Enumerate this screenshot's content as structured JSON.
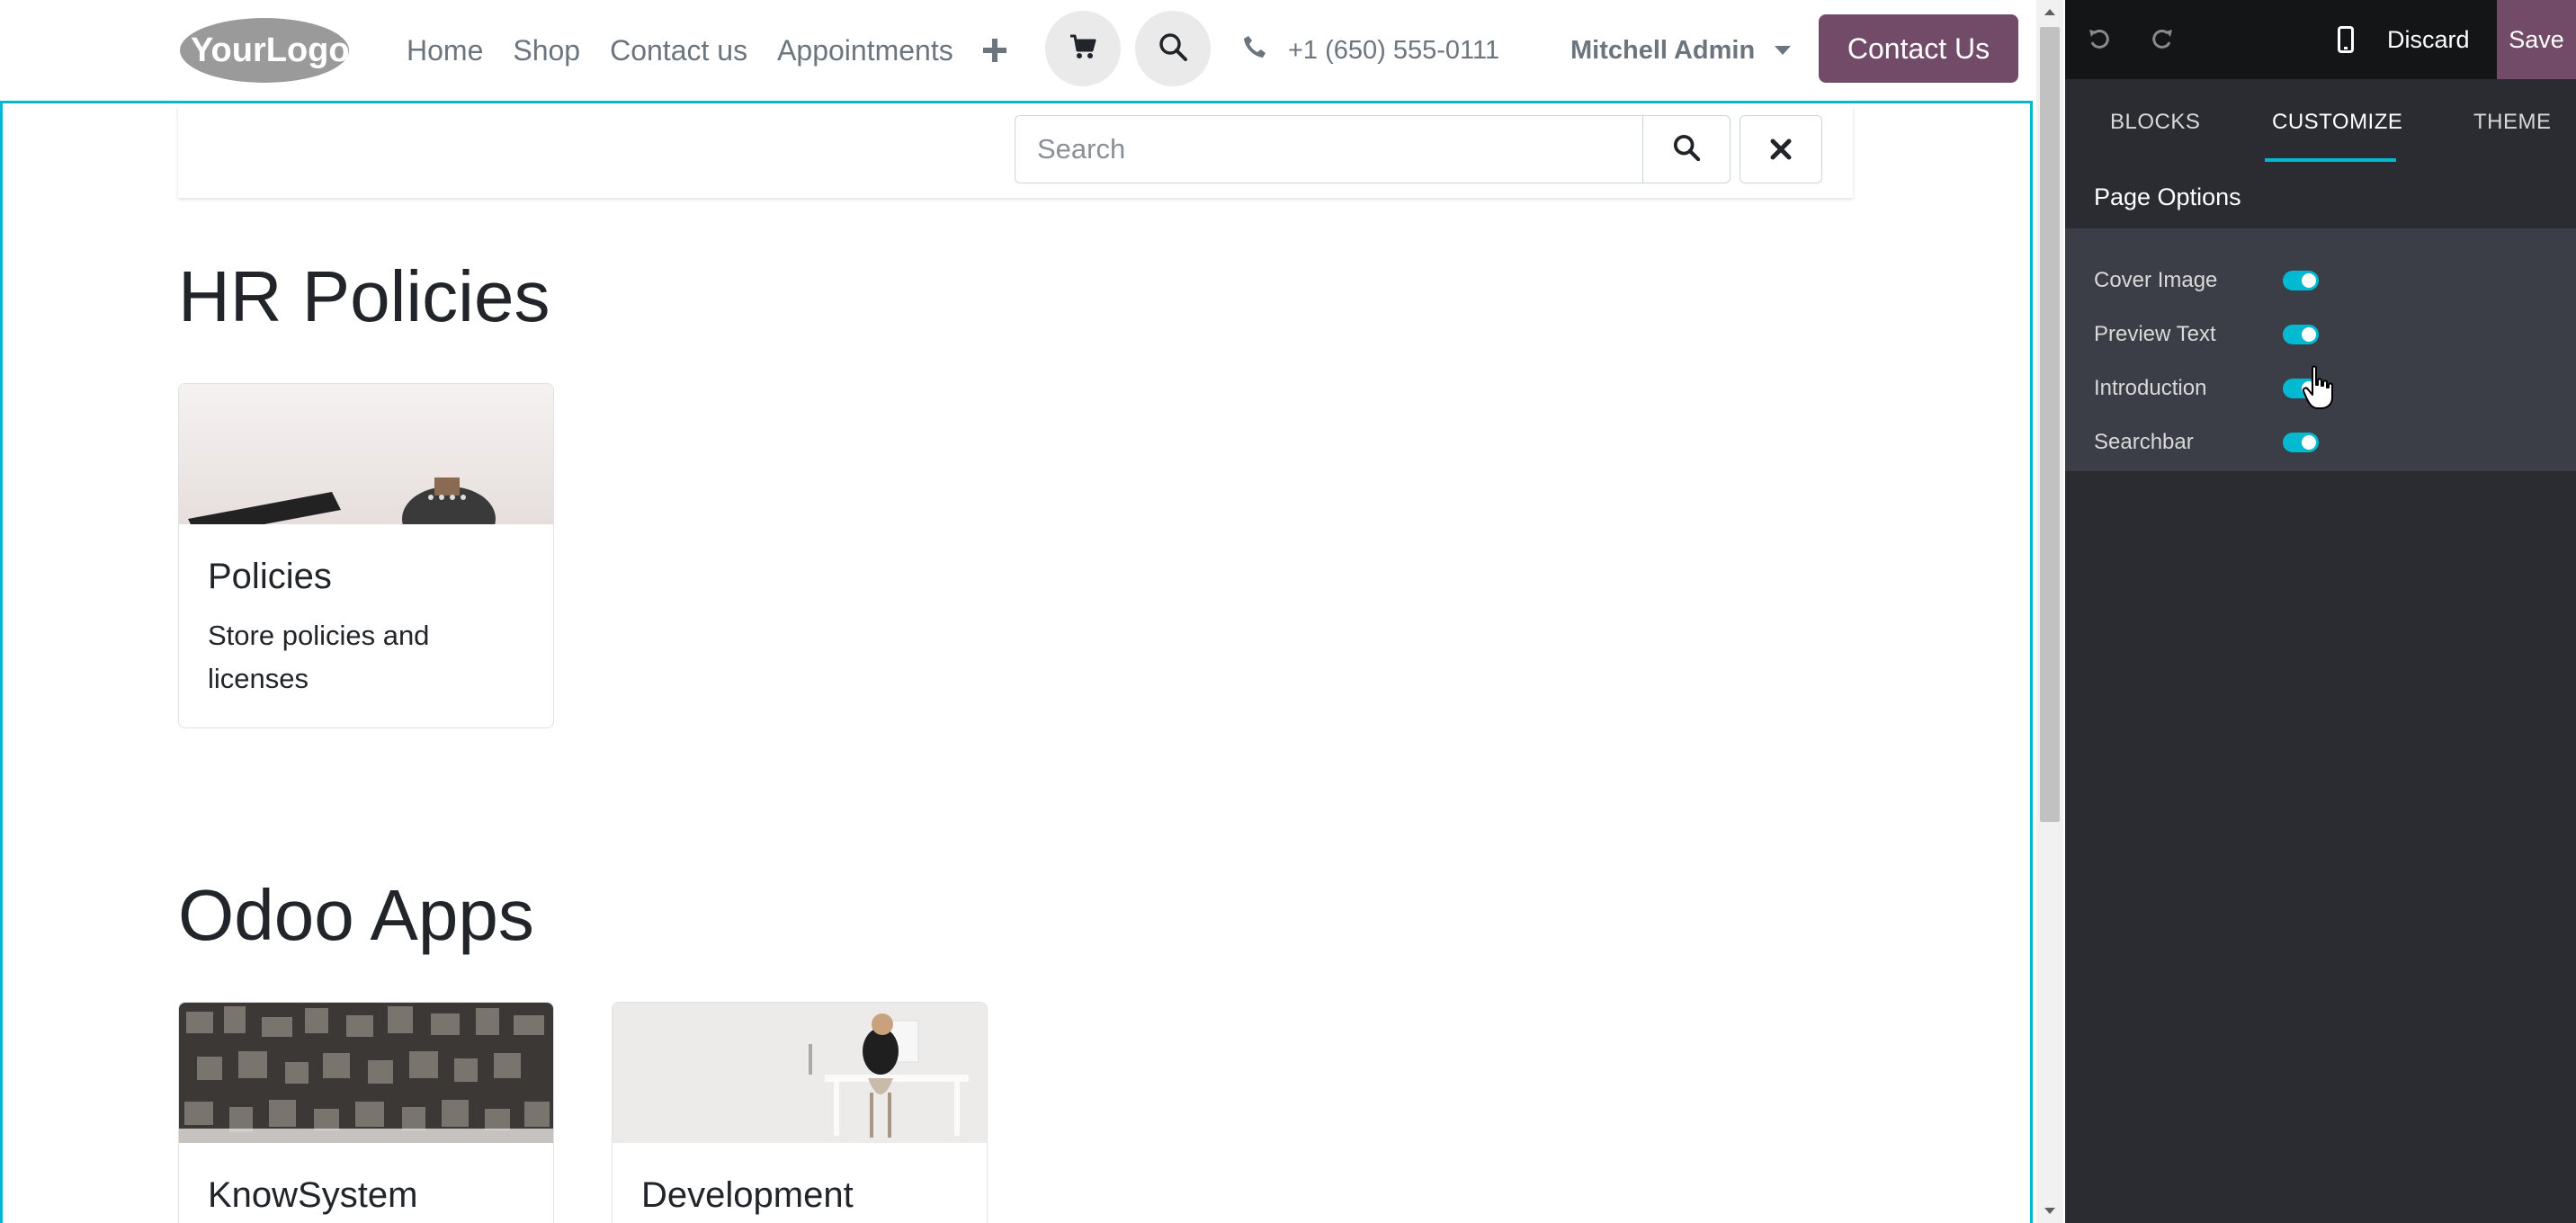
{
  "navbar": {
    "logo_text": "YourLogo",
    "links": [
      "Home",
      "Shop",
      "Contact us",
      "Appointments"
    ],
    "add_icon": "plus-icon",
    "cart_icon": "cart-icon",
    "search_icon": "search-icon",
    "phone_icon": "phone-icon",
    "phone": "+1 (650) 555-0111",
    "user": "Mitchell Admin",
    "cta": "Contact Us"
  },
  "search": {
    "placeholder": "Search"
  },
  "sections": [
    {
      "title": "HR Policies",
      "cards": [
        {
          "title": "Policies",
          "description": "Store policies and licenses"
        }
      ]
    },
    {
      "title": "Odoo Apps",
      "cards": [
        {
          "title": "KnowSystem",
          "description": ""
        },
        {
          "title": "Development",
          "description": ""
        }
      ]
    }
  ],
  "panel": {
    "discard": "Discard",
    "save": "Save",
    "tabs": [
      "BLOCKS",
      "CUSTOMIZE",
      "THEME"
    ],
    "active_tab": "CUSTOMIZE",
    "section_header": "Page Options",
    "options": [
      {
        "label": "Cover Image",
        "enabled": true
      },
      {
        "label": "Preview Text",
        "enabled": true
      },
      {
        "label": "Introduction",
        "enabled": true
      },
      {
        "label": "Searchbar",
        "enabled": true
      }
    ]
  },
  "colors": {
    "brand": "#714b67",
    "accent": "#01bad2",
    "panel_bg": "#2b2c31"
  }
}
